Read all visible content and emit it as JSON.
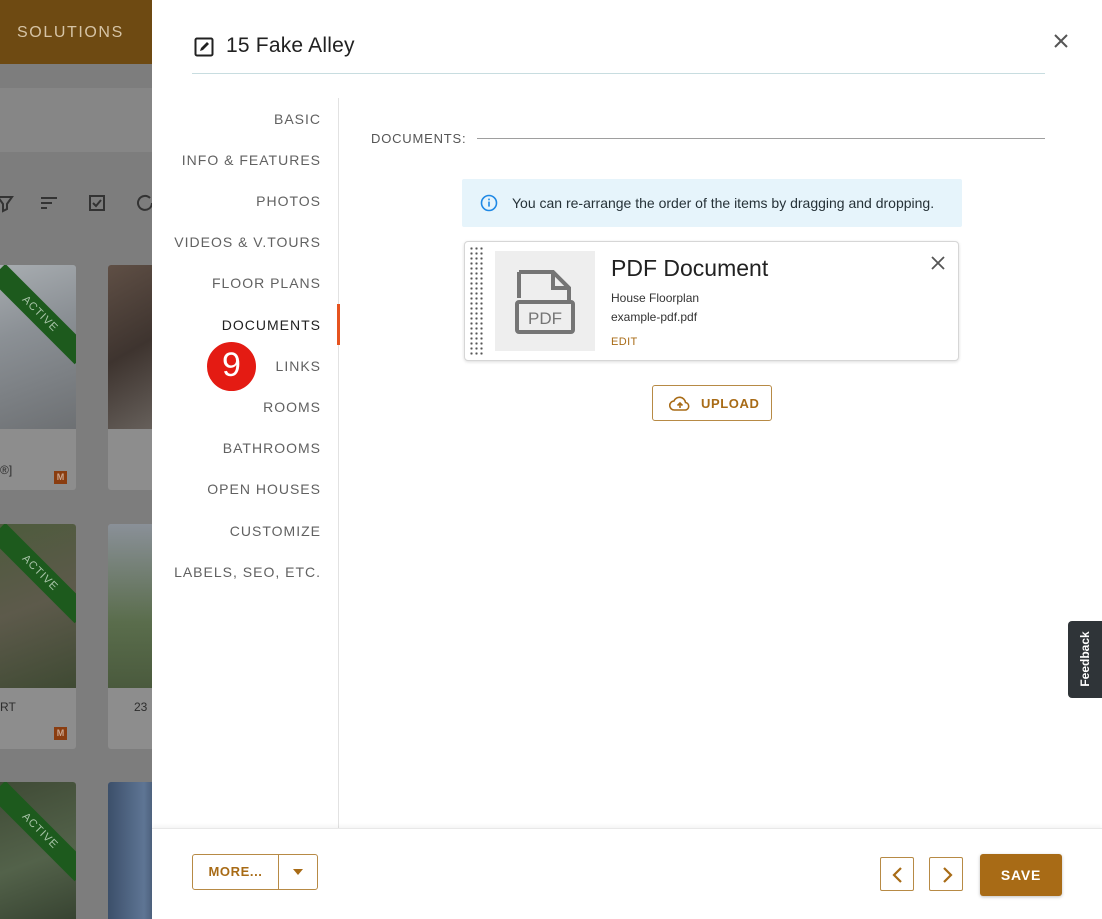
{
  "background": {
    "nav_label": "SOLUTIONS",
    "cards": [
      {
        "ribbon": "ACTIVE",
        "caption": "®]",
        "badge": "M"
      },
      {
        "ribbon": "ACTIVE",
        "caption": "RT",
        "badge": "M"
      },
      {
        "ribbon": "ACTIVE"
      }
    ],
    "captions_col2": [
      "",
      "23"
    ]
  },
  "modal": {
    "title": "15 Fake Alley",
    "close_icon": "close-icon",
    "sidenav": {
      "items": [
        {
          "label": "BASIC"
        },
        {
          "label": "INFO & FEATURES"
        },
        {
          "label": "PHOTOS"
        },
        {
          "label": "VIDEOS & V.TOURS"
        },
        {
          "label": "FLOOR PLANS"
        },
        {
          "label": "DOCUMENTS",
          "active": true
        },
        {
          "label": "LINKS"
        },
        {
          "label": "ROOMS"
        },
        {
          "label": "BATHROOMS"
        },
        {
          "label": "OPEN HOUSES"
        },
        {
          "label": "CUSTOMIZE"
        },
        {
          "label": "LABELS, SEO, ETC."
        }
      ],
      "step_badge": "9"
    },
    "documents": {
      "section_label": "DOCUMENTS:",
      "info_text": "You can re-arrange the order of the items by dragging and dropping.",
      "items": [
        {
          "title": "PDF Document",
          "description": "House Floorplan",
          "filename": "example-pdf.pdf",
          "edit_label": "EDIT",
          "thumb_label": "PDF"
        }
      ],
      "upload_label": "UPLOAD"
    },
    "footer": {
      "more_label": "MORE...",
      "save_label": "SAVE"
    }
  },
  "feedback_label": "Feedback",
  "colors": {
    "accent": "#a86b16",
    "active_indicator": "#e6531f",
    "badge": "#e41b13",
    "info_bg": "#e6f4fb",
    "info_icon": "#1e88e5"
  }
}
